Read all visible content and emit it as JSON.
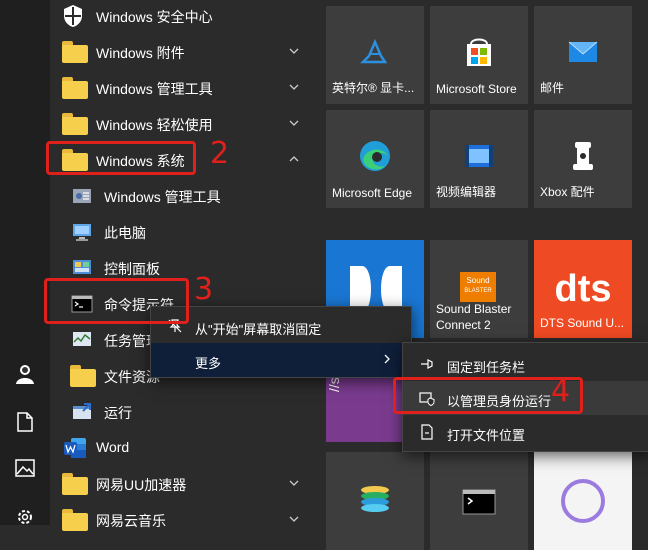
{
  "app_list": {
    "items": [
      {
        "label": "Windows 安全中心",
        "icon": "shield-icon"
      },
      {
        "label": "Windows 附件",
        "icon": "folder-icon",
        "expand": "chevron-down-icon"
      },
      {
        "label": "Windows 管理工具",
        "icon": "folder-icon",
        "expand": "chevron-down-icon"
      },
      {
        "label": "Windows 轻松使用",
        "icon": "folder-icon",
        "expand": "chevron-down-icon"
      },
      {
        "label": "Windows 系统",
        "icon": "folder-icon",
        "expand": "chevron-up-icon"
      },
      {
        "label": "Windows 管理工具",
        "icon": "admin-tools-icon"
      },
      {
        "label": "此电脑",
        "icon": "computer-icon"
      },
      {
        "label": "控制面板",
        "icon": "control-panel-icon"
      },
      {
        "label": "命令提示符",
        "icon": "cmd-icon"
      },
      {
        "label": "任务管理",
        "icon": "task-manager-icon"
      },
      {
        "label": "文件资源",
        "icon": "file-explorer-icon"
      },
      {
        "label": "运行",
        "icon": "run-icon"
      },
      {
        "label": "Word",
        "icon": "word-icon"
      },
      {
        "label": "网易UU加速器",
        "icon": "folder-icon",
        "expand": "chevron-down-icon"
      },
      {
        "label": "网易云音乐",
        "icon": "folder-icon",
        "expand": "chevron-down-icon"
      }
    ]
  },
  "tiles": [
    {
      "label": "英特尔® 显卡...",
      "icon": "intel-graphics-icon"
    },
    {
      "label": "Microsoft Store",
      "icon": "store-icon"
    },
    {
      "label": "邮件",
      "icon": "mail-icon"
    },
    {
      "label": "Microsoft Edge",
      "icon": "edge-icon"
    },
    {
      "label": "视频编辑器",
      "icon": "video-editor-icon"
    },
    {
      "label": "Xbox 配件",
      "icon": "xbox-accessories-icon"
    },
    {
      "label": "",
      "icon": "dolby-icon"
    },
    {
      "label": "Sound Blaster Connect 2",
      "line1": "Sound Blaster",
      "line2": "Connect 2",
      "icon": "sound-blaster-icon"
    },
    {
      "label": "DTS Sound U...",
      "icon": "dts-icon"
    },
    {
      "label": "",
      "icon": "cmd-tile-icon"
    }
  ],
  "sound_blaster_logo": {
    "line1": "Sound",
    "line2": "BLASTER"
  },
  "dts_logo": "dts",
  "shell_tile_text": "//shell",
  "context_menu": {
    "items": [
      {
        "label": "从\"开始\"屏幕取消固定",
        "icon": "unpin-icon"
      },
      {
        "label": "更多",
        "icon": "",
        "submenu": "chevron-right-icon"
      }
    ]
  },
  "submenu": {
    "items": [
      {
        "label": "固定到任务栏",
        "icon": "pin-icon"
      },
      {
        "label": "以管理员身份运行",
        "icon": "admin-shield-icon"
      },
      {
        "label": "打开文件位置",
        "icon": "open-folder-icon"
      }
    ]
  },
  "annotations": {
    "step2": "2",
    "step3": "3",
    "step4": "4"
  },
  "colors": {
    "annotation_red": "#e0201a",
    "folder_yellow": "#f6cf4d",
    "tile_bg": "#3d3d3d",
    "dolby_bg": "#1976d2",
    "sound_blaster_bg": "#ef7d00",
    "dts_bg": "#ee4a23"
  }
}
